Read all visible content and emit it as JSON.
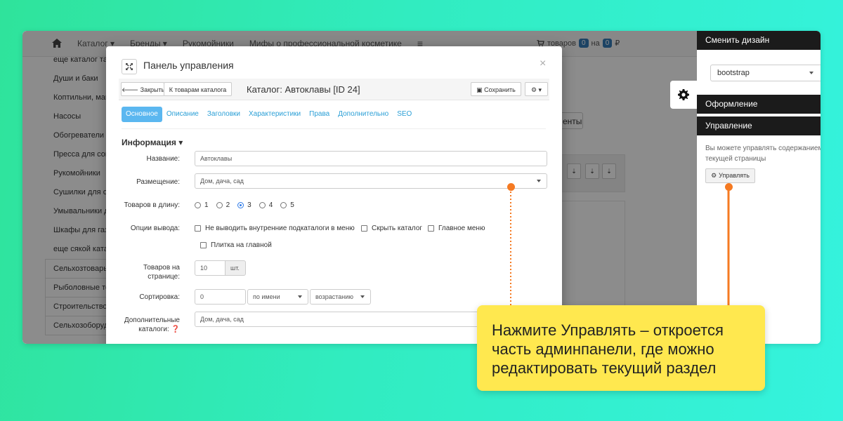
{
  "site": {
    "nav": {
      "home_icon": "home-icon",
      "items": [
        "Каталог ▾",
        "Бренды ▾",
        "Рукомойники",
        "Мифы о профессиональной косметике"
      ],
      "cart_prefix": "товаров",
      "cart_count": "0",
      "cart_mid": "на",
      "cart_sum": "0",
      "cart_currency": "₽"
    },
    "sidebar": [
      "еще каталог такой",
      "Души и баки",
      "Коптильни, мангалы",
      "Насосы",
      "Обогреватели",
      "Пресса для сока",
      "Рукомойники",
      "Сушилки для овощей",
      "Умывальники для дачи",
      "Шкафы для газа",
      "еще сякой каталог",
      "Сельхозтовары",
      "Рыболовные товары",
      "Строительство",
      "Сельхозоборудование"
    ],
    "bg_button": "енты"
  },
  "modal": {
    "title": "Панель управления",
    "close": "×",
    "toolbar": {
      "close_label": "Закрыть",
      "to_products": "К товарам каталога",
      "catalog_title": "Каталог: Автоклавы [ID 24]",
      "save_label": "Сохранить"
    },
    "tabs": [
      "Основное",
      "Описание",
      "Заголовки",
      "Характеристики",
      "Права",
      "Дополнительно",
      "SEO"
    ],
    "section_title": "Информация ▾",
    "fields": {
      "name_label": "Название:",
      "name_value": "Автоклавы",
      "placement_label": "Размещение:",
      "placement_value": "Дом, дача, сад",
      "per_row_label": "Товаров в длину:",
      "per_row_options": [
        "1",
        "2",
        "3",
        "4",
        "5"
      ],
      "per_row_selected": "3",
      "output_label": "Опции вывода:",
      "output_options": [
        "Не выводить внутренние подкаталоги в меню",
        "Скрыть каталог",
        "Главное меню",
        "Плитка на главной"
      ],
      "per_page_label_1": "Товаров на",
      "per_page_label_2": "странице:",
      "per_page_value": "10",
      "per_page_unit": "шт.",
      "sort_label": "Сортировка:",
      "sort_value": "0",
      "sort_by": "по имени",
      "sort_dir": "возрастанию",
      "extra_label_1": "Дополнительные",
      "extra_label_2": "каталоги:",
      "extra_value": "Дом, дача, сад"
    }
  },
  "admin": {
    "design_header": "Сменить дизайн",
    "design_value": "bootstrap",
    "appearance_header": "Оформление",
    "manage_header": "Управление",
    "desc_1": "Вы можете управлять содержанием",
    "desc_2": "текущей страницы",
    "manage_button": "Управлять"
  },
  "callout": {
    "line1": "Нажмите Управлять – откроется",
    "line2": "часть админпанели, где можно",
    "line3": "редактировать текущий раздел"
  },
  "colors": {
    "accent_orange": "#f57a22",
    "callout_yellow": "#ffe84f",
    "tab_active": "#5bb7f0",
    "link_blue": "#2a9fd6"
  }
}
